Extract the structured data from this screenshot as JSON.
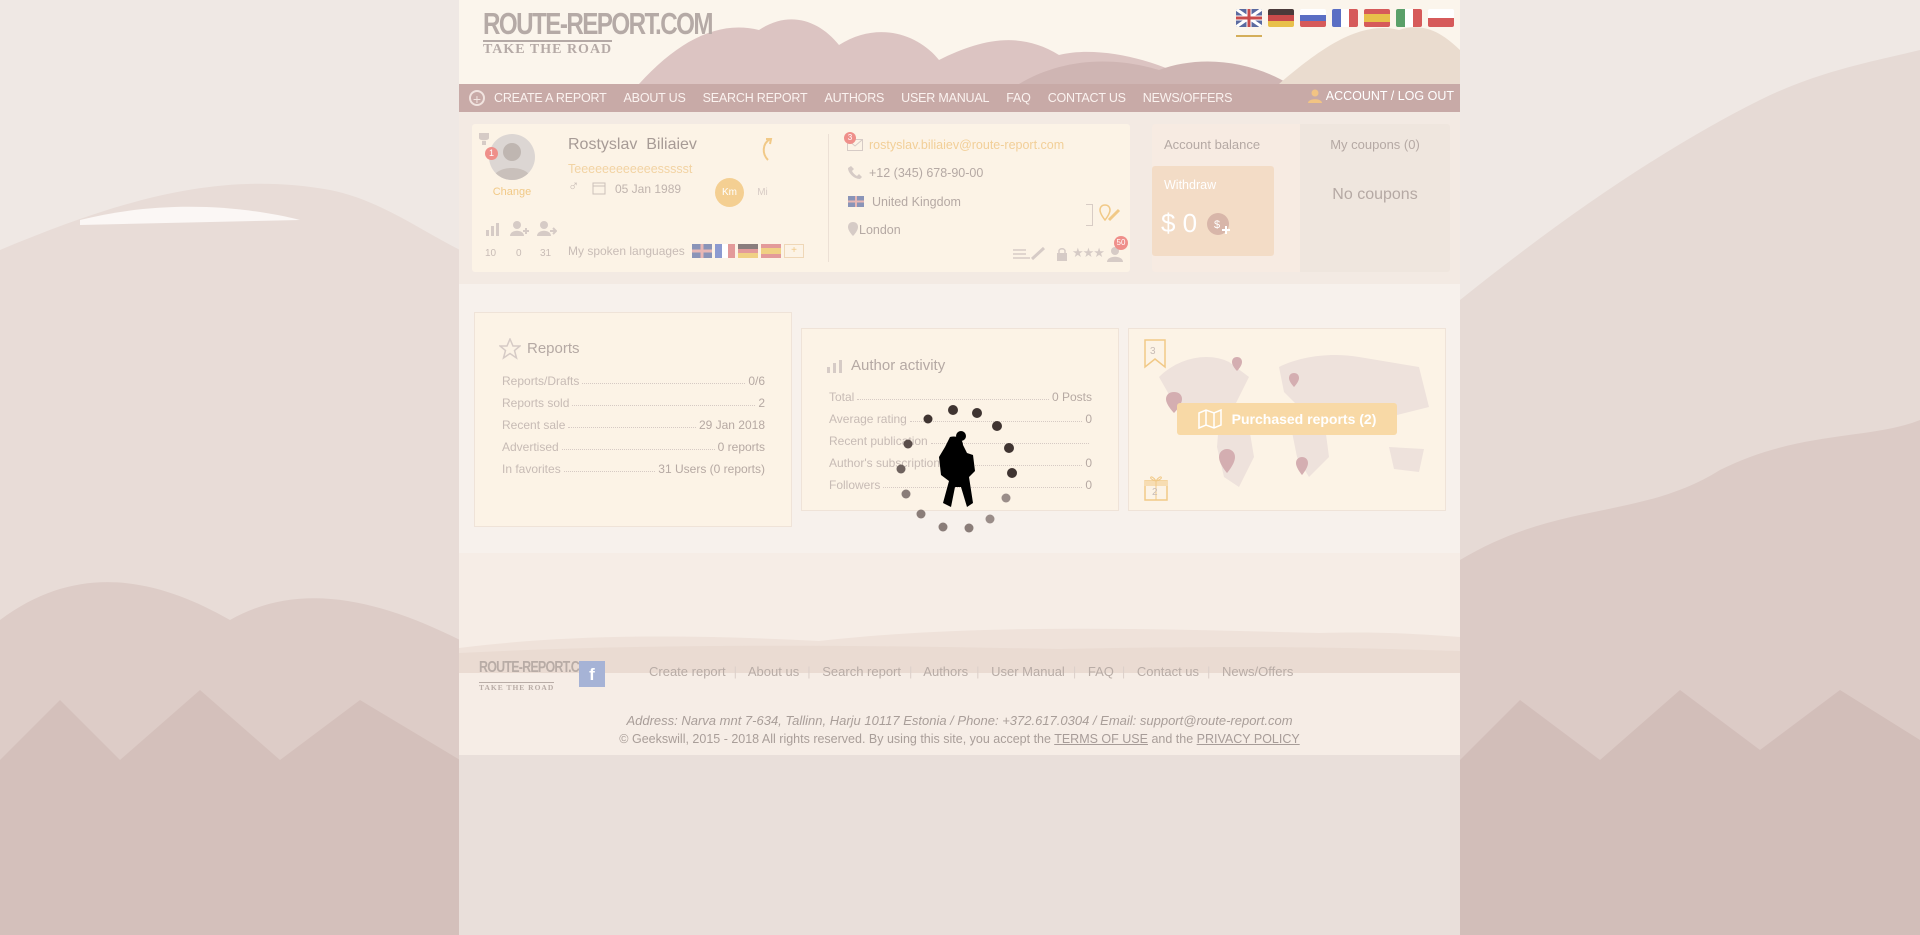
{
  "site": {
    "logo_main": "ROUTE-REPORT.COM",
    "logo_tagline": "TAKE THE ROAD"
  },
  "nav": {
    "items": [
      "CREATE A REPORT",
      "ABOUT US",
      "SEARCH REPORT",
      "AUTHORS",
      "USER MANUAL",
      "FAQ",
      "CONTACT US",
      "NEWS/OFFERS"
    ],
    "account": "ACCOUNT / LOG OUT"
  },
  "flags": [
    "english-flag",
    "german-flag",
    "russian-flag",
    "french-flag",
    "spanish-flag",
    "italian-flag",
    "polish-flag"
  ],
  "profile": {
    "name": "Rostyslav  Biliaiev",
    "status": "Teeeeeeeeeeeessssst",
    "avatar_badge": "1",
    "change": "Change",
    "birthdate": "05 Jan 1989",
    "unit_km": "Km",
    "unit_mi": "Mi",
    "stats": [
      "10",
      "0",
      "31"
    ],
    "languages_label": "My spoken languages",
    "email": "rostyslav.biliaiev@route-report.com",
    "email_badge": "3",
    "phone": "+12 (345) 678-90-00",
    "country": "United Kingdom",
    "city": "London",
    "badge_count": "50"
  },
  "balance": {
    "title": "Account balance",
    "withdraw": "Withdraw",
    "amount": "$ 0",
    "coupons_title": "My coupons (0)",
    "coupons_empty": "No coupons"
  },
  "reports": {
    "title": "Reports",
    "rows": [
      {
        "k": "Reports/Drafts",
        "v": "0/6"
      },
      {
        "k": "Reports sold",
        "v": "2"
      },
      {
        "k": "Recent sale",
        "v": "29 Jan 2018"
      },
      {
        "k": "Advertised",
        "v": "0 reports"
      },
      {
        "k": "In favorites",
        "v": "31 Users (0 reports)"
      }
    ]
  },
  "activity": {
    "title": "Author activity",
    "rows": [
      {
        "k": "Total",
        "v": "0 Posts"
      },
      {
        "k": "Average rating",
        "v": "0"
      },
      {
        "k": "Recent publication",
        "v": ""
      },
      {
        "k": "Author's subscription",
        "v": "0"
      },
      {
        "k": "Followers",
        "v": "0"
      }
    ]
  },
  "map": {
    "bookmark_count": "3",
    "gift_count": "2",
    "purchased": "Purchased reports (2)"
  },
  "footer": {
    "links": [
      "Create report",
      "About us",
      "Search report",
      "Authors",
      "User Manual",
      "FAQ",
      "Contact us",
      "News/Offers"
    ],
    "address": "Address: Narva mnt 7-634, Tallinn, Harju 10117 Estonia / Phone: +372.617.0304 / Email: support@route-report.com",
    "copyright": "© Geekswill, 2015 - 2018 All rights reserved. By using this site, you accept the",
    "terms": "TERMS OF USE",
    "and": "and the",
    "privacy": "PRIVACY POLICY"
  },
  "colors": {
    "nav": "#c8aaa7",
    "accent": "#f3c77f",
    "page": "#f7f1ec"
  }
}
